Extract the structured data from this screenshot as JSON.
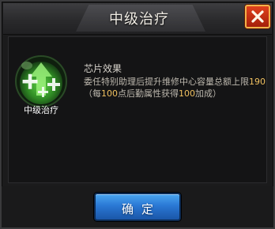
{
  "dialog": {
    "title": "中级治疗",
    "close_icon": "close-x-icon"
  },
  "chip": {
    "label": "中级治疗",
    "icon": "healing-arrow-plus-icon",
    "colors": {
      "ring": "#1f3a1e",
      "core": "#46b434",
      "arrow": "#7ae85a"
    }
  },
  "effect": {
    "title": "芯片效果",
    "line1_prefix": "委任特别助理后提升维修中心容量总额上限",
    "line1_value": "190",
    "line2_prefix": "（每",
    "line2_value1": "100",
    "line2_mid": "点后勤属性获得",
    "line2_value2": "100",
    "line2_suffix": "加成）"
  },
  "confirm_button": {
    "label": "确定"
  },
  "colors": {
    "highlight": "#f0c060",
    "button_blue": "#2a78d4",
    "close_red": "#c8321a"
  }
}
